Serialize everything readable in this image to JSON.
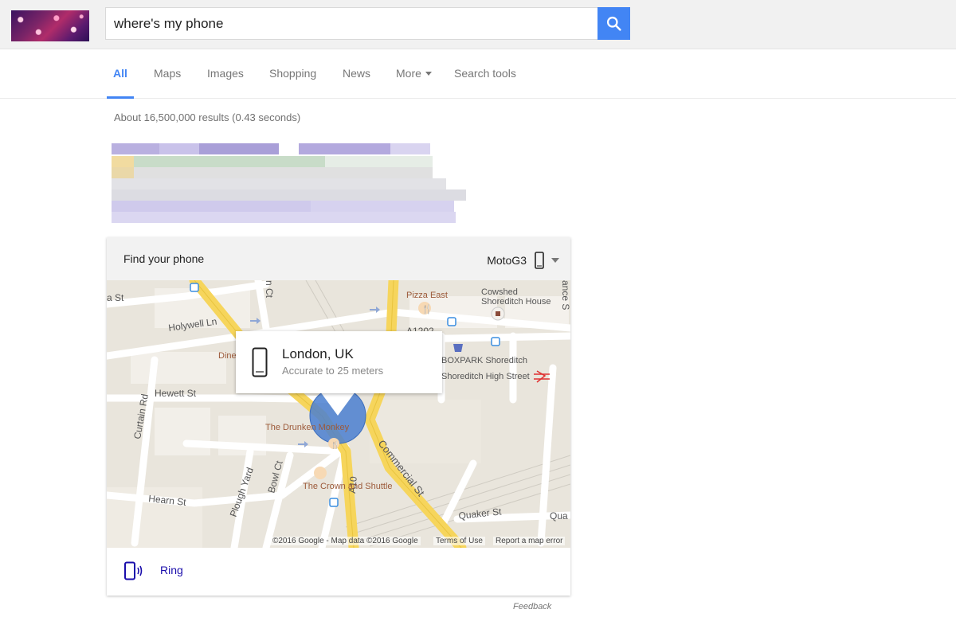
{
  "search": {
    "query": "where's my phone"
  },
  "tabs": [
    {
      "label": "All"
    },
    {
      "label": "Maps"
    },
    {
      "label": "Images"
    },
    {
      "label": "Shopping"
    },
    {
      "label": "News"
    },
    {
      "label": "More"
    },
    {
      "label": "Search tools"
    }
  ],
  "result_stats": "About 16,500,000 results (0.43 seconds)",
  "card": {
    "title": "Find your phone",
    "device_name": "MotoG3",
    "popup": {
      "location": "London, UK",
      "accuracy": "Accurate to 25 meters"
    },
    "map": {
      "labels": {
        "street_a": "a St",
        "holywell": "Holywell Ln",
        "curtain": "Curtain Rd",
        "hewett": "Hewett St",
        "hearn": "Hearn St",
        "plough": "Plough Yard",
        "bowl": "Bowl Ct",
        "a10": "A10",
        "a1202": "A1202",
        "commercial": "Commercial St",
        "quaker": "Quaker St",
        "qua": "Qua",
        "nct": "n Ct",
        "ance": "ance S",
        "pizza_east": "Pizza East",
        "cowshed": "Cowshed",
        "cowshed_house": "Shoreditch House",
        "boxpark": "BOXPARK Shoreditch",
        "shoreditch_high": "Shoreditch High Street",
        "dine": "Dine",
        "drunken_monkey": "The Drunken Monkey",
        "crown_shuttle": "The Crown and Shuttle"
      },
      "copyright": "©2016 Google - Map data ©2016 Google",
      "terms": "Terms of Use",
      "report": "Report a map error"
    },
    "ring_label": "Ring"
  },
  "feedback": "Feedback",
  "colors": {
    "accent": "#4285f4",
    "link": "#1a0dab",
    "map_major_road": "#f5d24a",
    "location_circle": "#4a7fd0"
  }
}
